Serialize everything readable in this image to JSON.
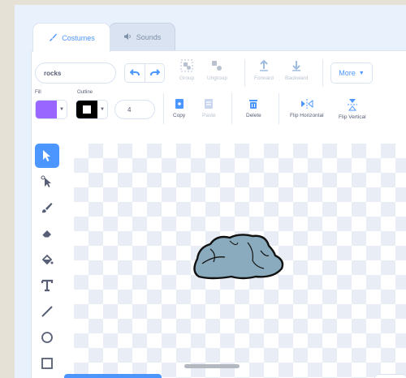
{
  "tabs": {
    "costumes": "Costumes",
    "sounds": "Sounds"
  },
  "toolbar": {
    "costume_name": "rocks",
    "group": "Group",
    "ungroup": "Ungroup",
    "forward": "Forward",
    "backward": "Backward",
    "more": "More",
    "fill_label": "Fill",
    "outline_label": "Outline",
    "outline_size": "4",
    "copy": "Copy",
    "paste": "Paste",
    "delete": "Delete",
    "flip_horizontal": "Flip Horizontal",
    "flip_vertical": "Flip Vertical"
  },
  "colors": {
    "accent": "#4c97ff",
    "fill": "#9966ff",
    "outline": "#000000",
    "rock_fill": "#8aabbd"
  },
  "tools": [
    "select-icon",
    "reshape-icon",
    "brush-icon",
    "eraser-icon",
    "fill-bucket-icon",
    "text-icon",
    "line-icon",
    "circle-icon",
    "rectangle-icon"
  ]
}
